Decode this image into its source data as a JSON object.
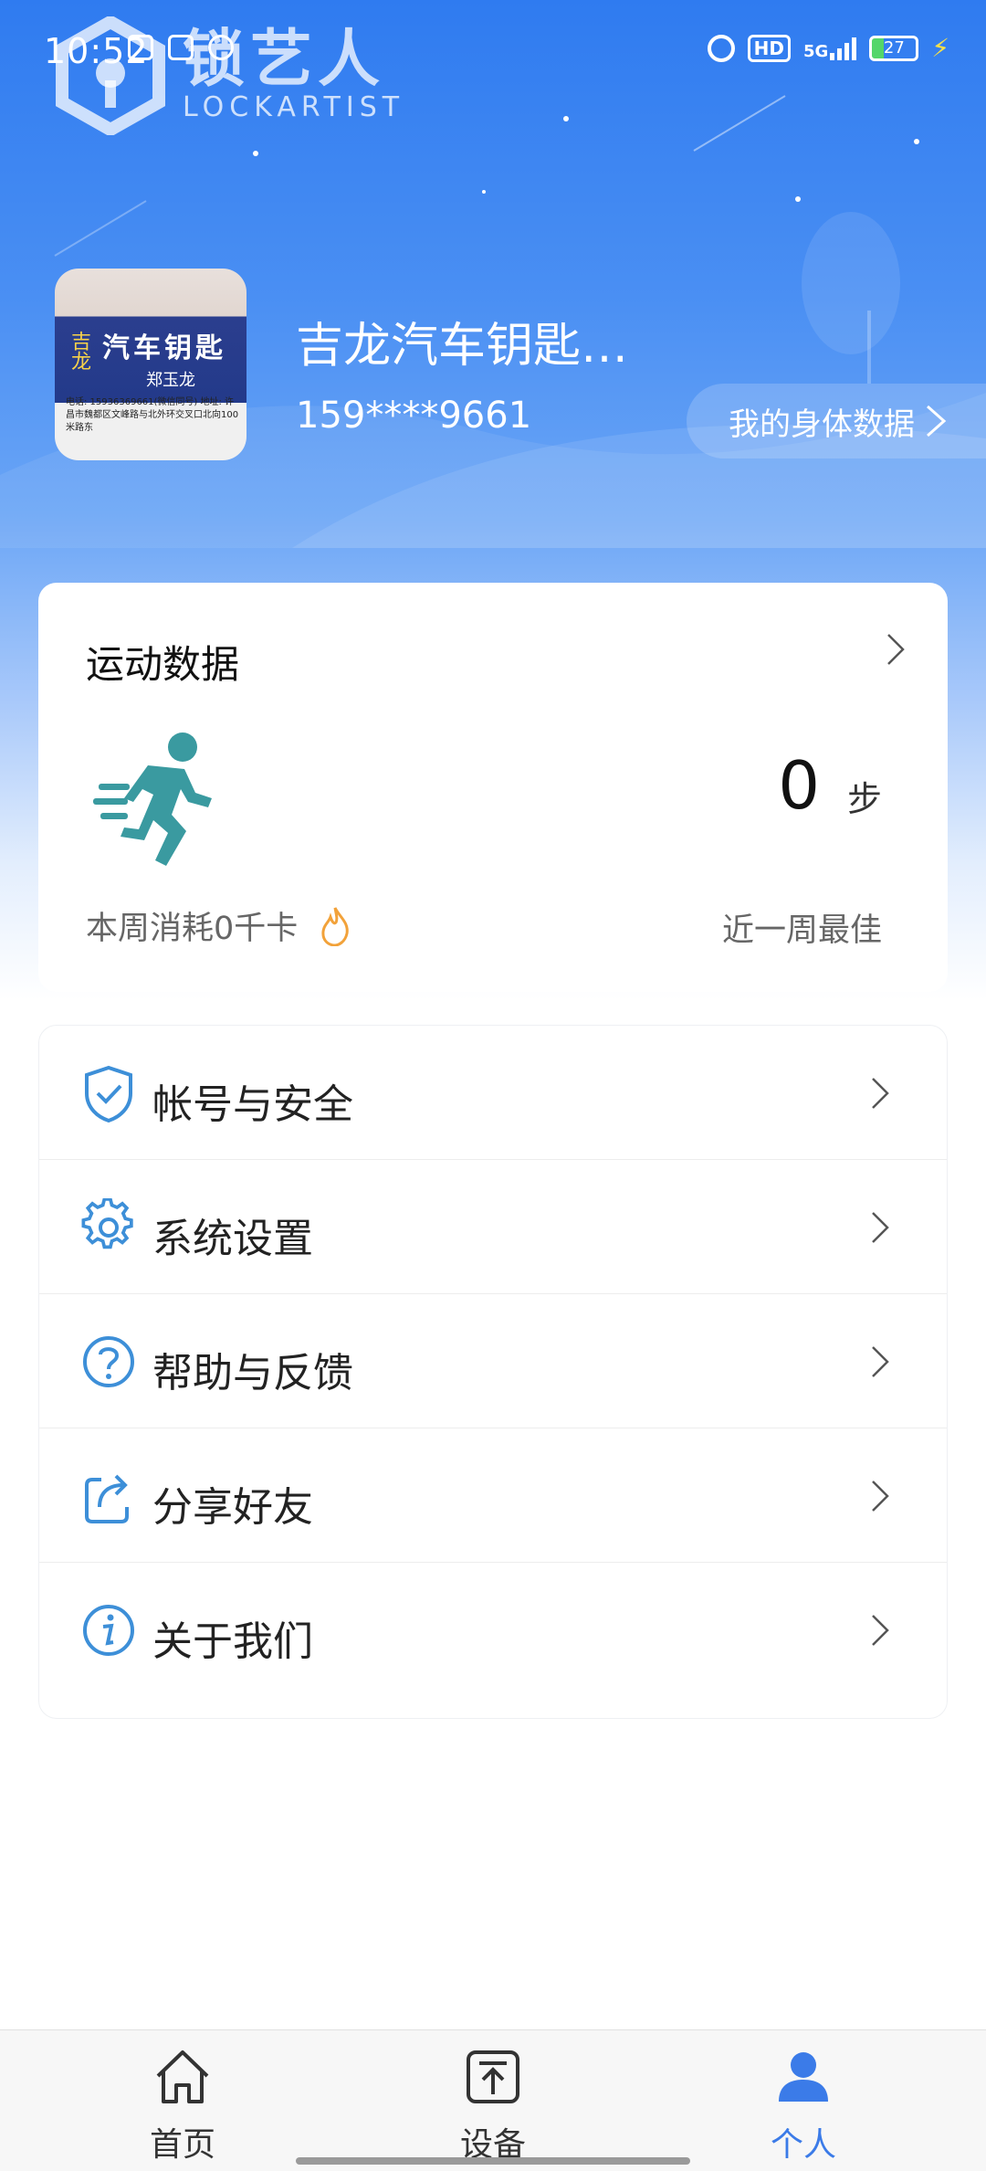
{
  "status_bar": {
    "time": "10:52",
    "network": "5G",
    "hd_label": "HD",
    "battery": "27"
  },
  "logo": {
    "cn": "锁艺人",
    "en": "LOCKARTIST"
  },
  "profile": {
    "avatar_line1": "汽车钥匙",
    "avatar_line2": "郑玉龙",
    "avatar_side": "吉龙",
    "avatar_small": "电话: 15936369661(微信同号) 地址: 许昌市魏都区文峰路与北外环交叉口北向100米路东",
    "name": "吉龙汽车钥匙…",
    "phone": "159****9661",
    "body_data_label": "我的身体数据"
  },
  "sports_card": {
    "title": "运动数据",
    "steps_value": "0",
    "steps_unit": "步",
    "week_consume": "本周消耗0千卡",
    "week_best": "近一周最佳"
  },
  "menu": [
    {
      "label": "帐号与安全",
      "icon": "shield-check-icon"
    },
    {
      "label": "系统设置",
      "icon": "gear-icon"
    },
    {
      "label": "帮助与反馈",
      "icon": "question-circle-icon"
    },
    {
      "label": "分享好友",
      "icon": "share-icon"
    },
    {
      "label": "关于我们",
      "icon": "info-icon"
    }
  ],
  "tabbar": {
    "tabs": [
      {
        "label": "首页",
        "icon": "home-icon",
        "active": false
      },
      {
        "label": "设备",
        "icon": "device-upload-icon",
        "active": false
      },
      {
        "label": "个人",
        "icon": "person-icon",
        "active": true
      }
    ]
  },
  "colors": {
    "accent": "#3b7be8",
    "icon_blue": "#3d8fd8",
    "tab_inactive": "#333333",
    "tab_active": "#3b7be8",
    "runner": "#3a9aa0",
    "flame": "#f2a23a"
  }
}
